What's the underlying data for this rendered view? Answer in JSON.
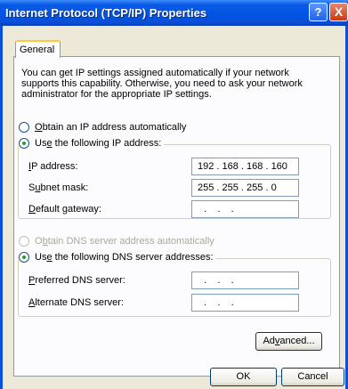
{
  "window": {
    "title": "Internet Protocol (TCP/IP) Properties",
    "help_glyph": "?",
    "close_glyph": "X"
  },
  "tabs": [
    {
      "label": "General",
      "selected": true
    }
  ],
  "intro_text": "You can get IP settings assigned automatically if your network supports this capability. Otherwise, you need to ask your network administrator for the appropriate IP settings.",
  "ip_mode": {
    "auto": {
      "first": "O",
      "rest": "btain an IP address automatically",
      "checked": false
    },
    "manual": {
      "first": "Us",
      "key": "e",
      "rest": " the following IP address:",
      "checked": true
    }
  },
  "ip_fields": {
    "ip_address": {
      "key": "I",
      "rest": "P address:",
      "value": "192 . 168 . 168 . 160"
    },
    "subnet_mask": {
      "pre": "S",
      "key": "u",
      "rest": "bnet mask:",
      "value": "255 . 255 . 255 .  0"
    },
    "default_gateway": {
      "key": "D",
      "rest": "efault gateway:",
      "value": ""
    }
  },
  "dns_mode": {
    "auto": {
      "pre": "O",
      "key": "b",
      "rest": "tain DNS server address automatically",
      "checked": false,
      "disabled": true
    },
    "manual": {
      "pre": "Us",
      "key": "e",
      "rest": " the following DNS server addresses:",
      "checked": true
    }
  },
  "dns_fields": {
    "preferred": {
      "key": "P",
      "rest": "referred DNS server:",
      "value": ""
    },
    "alternate": {
      "key": "A",
      "rest": "lternate DNS server:",
      "value": ""
    }
  },
  "empty_ip_dots": "  .    .    .",
  "buttons": {
    "advanced": {
      "pre": "Ad",
      "key": "v",
      "rest": "anced..."
    },
    "ok": "OK",
    "cancel": "Cancel"
  }
}
